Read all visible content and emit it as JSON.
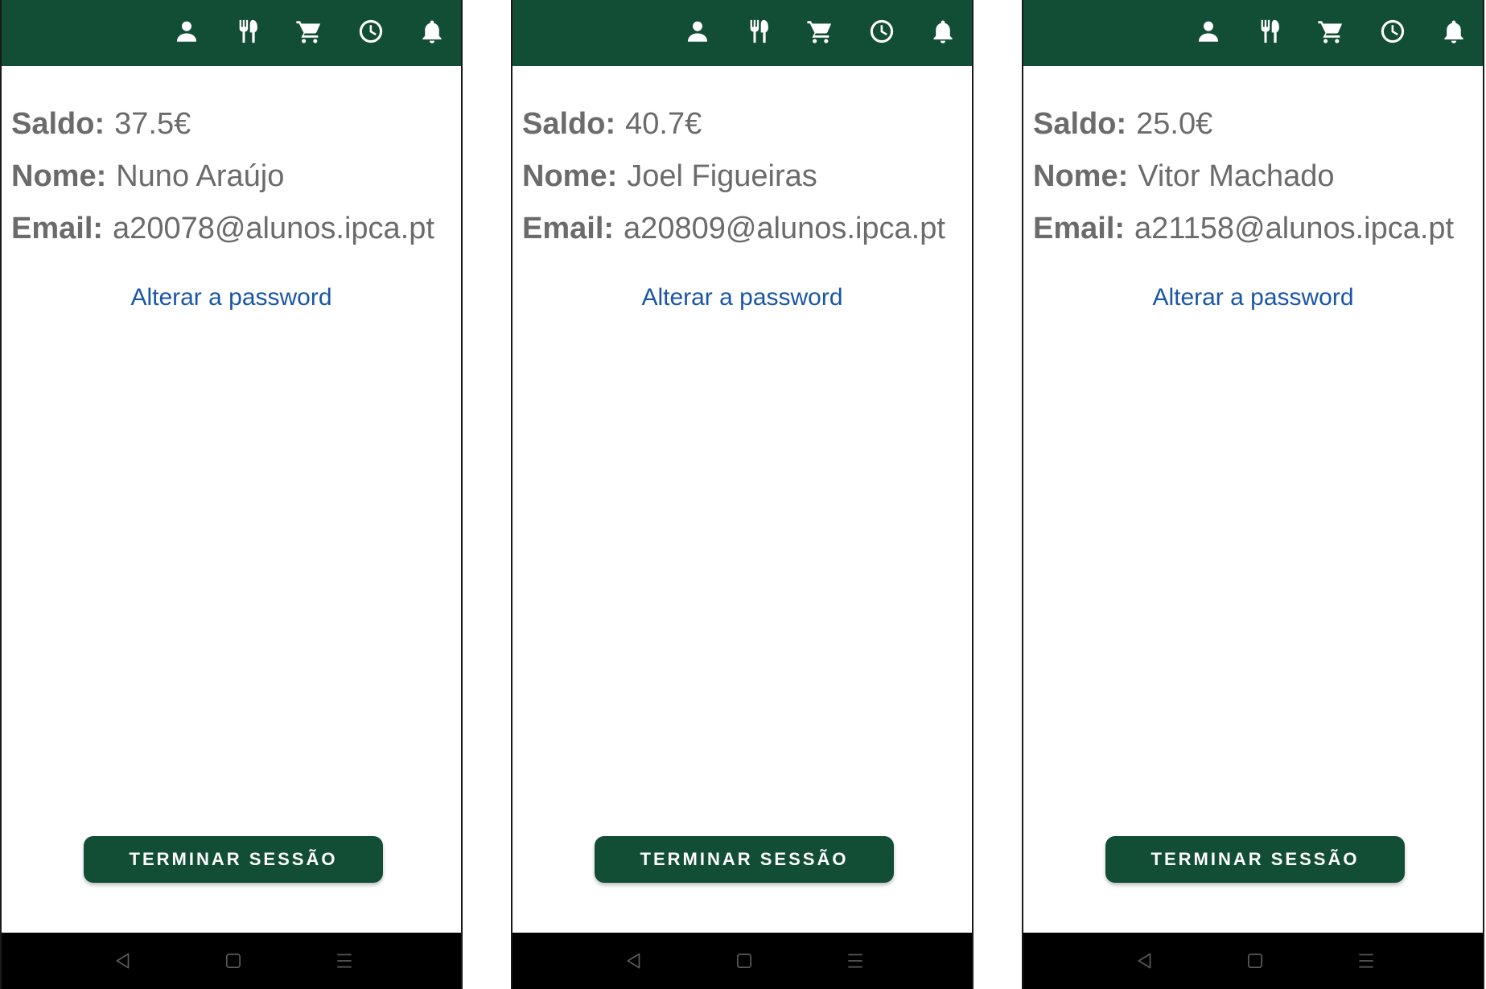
{
  "accent_color": "#124e35",
  "link_color": "#1a56a8",
  "topbar_icons": [
    "person-icon",
    "restaurant-icon",
    "cart-icon",
    "clock-icon",
    "bell-icon"
  ],
  "nav_icons": [
    "back-triangle-icon",
    "home-square-icon",
    "recents-lines-icon"
  ],
  "labels": {
    "saldo": "Saldo:",
    "nome": "Nome:",
    "email": "Email:",
    "change_password": "Alterar a password",
    "logout": "TERMINAR SESSÃO"
  },
  "screens": [
    {
      "saldo": "37.5€",
      "nome": "Nuno Araújo",
      "email": "a20078@alunos.ipca.pt"
    },
    {
      "saldo": "40.7€",
      "nome": "Joel Figueiras",
      "email": "a20809@alunos.ipca.pt"
    },
    {
      "saldo": "25.0€",
      "nome": "Vitor Machado",
      "email": "a21158@alunos.ipca.pt"
    }
  ]
}
